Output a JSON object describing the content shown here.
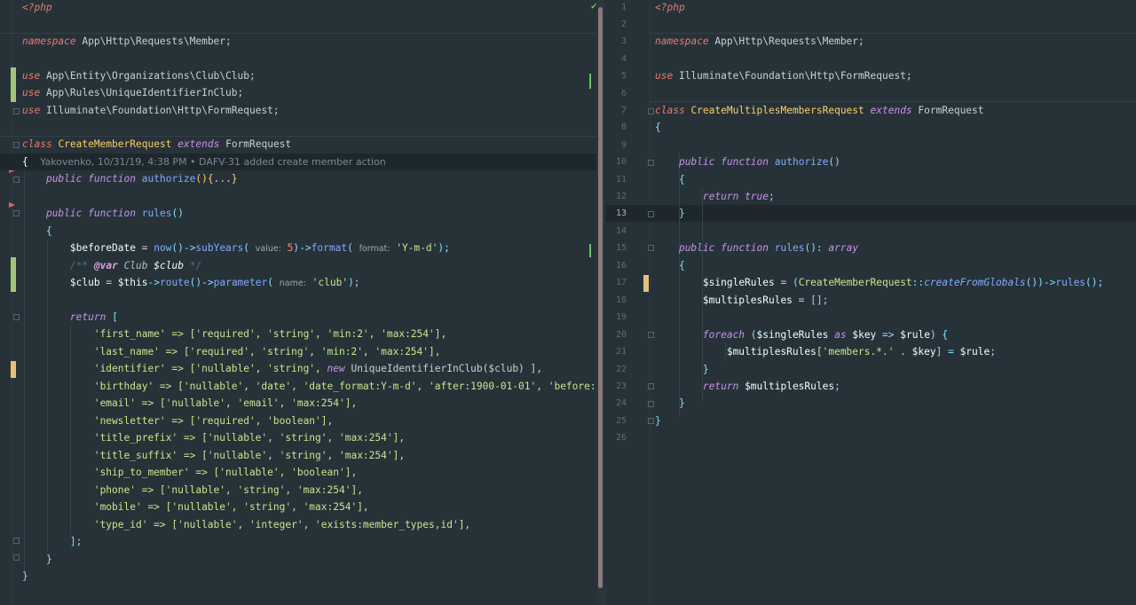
{
  "left": {
    "php_open": "<?php",
    "namespace_kw": "namespace",
    "namespace_value": "App\\Http\\Requests\\Member;",
    "use_kw": "use",
    "use1": "App\\Entity\\Organizations\\Club\\Club;",
    "use2": "App\\Rules\\UniqueIdentifierInClub;",
    "use3": "Illuminate\\Foundation\\Http\\FormRequest;",
    "class_kw": "class",
    "class_name": "CreateMemberRequest",
    "extends_kw": "extends",
    "parent": "FormRequest",
    "blame_brace": "{",
    "blame": "Yakovenko, 10/31/19, 4:38 PM • DAFV-31 added create member action",
    "public_kw": "public",
    "function_kw": "function",
    "authorize_fn": "authorize",
    "authorize_folded": "(){...}",
    "rules_fn": "rules",
    "parens": "()",
    "brace_open": "{",
    "brace_close": "}",
    "before_var": "$beforeDate",
    "eq": " = ",
    "now_fn": "now",
    "arrow": "()->",
    "subyears_fn": "subYears",
    "paren_open": "(",
    "hint_value": "value:",
    "five": "5",
    "arrow_close": ")->",
    "format_fn": "format",
    "hint_format": "format:",
    "ymd": "'Y-m-d'",
    "stmt_end": ");",
    "docblock_open": "/**",
    "docblock_var": "@var",
    "docblock_type": "Club",
    "docblock_name": "$club",
    "docblock_close": "*/",
    "club_var": "$club",
    "this_var": "$this",
    "arrow_op": "->",
    "route_fn": "route",
    "parameter_fn": "parameter",
    "hint_name": "name:",
    "club_str": "'club'",
    "return_kw": "return",
    "array_open": "[",
    "array_close": "];",
    "r_first_name": "'first_name' => ['required', 'string', 'min:2', 'max:254'],",
    "r_last_name": "'last_name' => ['required', 'string', 'min:2', 'max:254'],",
    "r_identifier_a": "'identifier' => ['nullable', 'string', ",
    "r_identifier_new": "new",
    "r_identifier_b": " UniqueIdentifierInClub($club) ],",
    "r_birthday": "'birthday' => ['nullable', 'date', 'date_format:Y-m-d', 'after:1900-01-01', 'before:' .",
    "r_email": "'email' => ['nullable', 'email', 'max:254'],",
    "r_newsletter": "'newsletter' => ['required', 'boolean'],",
    "r_title_prefix": "'title_prefix' => ['nullable', 'string', 'max:254'],",
    "r_title_suffix": "'title_suffix' => ['nullable', 'string', 'max:254'],",
    "r_ship": "'ship_to_member' => ['nullable', 'boolean'],",
    "r_phone": "'phone' => ['nullable', 'string', 'max:254'],",
    "r_mobile": "'mobile' => ['nullable', 'string', 'max:254'],",
    "r_type_id": "'type_id' => ['nullable', 'integer', 'exists:member_types,id'],",
    "method_close": "}",
    "class_close": "}"
  },
  "right": {
    "line_numbers": [
      "1",
      "2",
      "3",
      "4",
      "5",
      "6",
      "7",
      "8",
      "9",
      "10",
      "11",
      "12",
      "13",
      "14",
      "15",
      "16",
      "17",
      "18",
      "19",
      "20",
      "21",
      "22",
      "23",
      "24",
      "25",
      "26"
    ],
    "php_open": "<?php",
    "namespace_kw": "namespace",
    "namespace_value": "App\\Http\\Requests\\Member;",
    "use_kw": "use",
    "use1": "Illuminate\\Foundation\\Http\\FormRequest;",
    "class_kw": "class",
    "class_name": "CreateMultiplesMembersRequest",
    "extends_kw": "extends",
    "parent": "FormRequest",
    "brace_open": "{",
    "brace_close": "}",
    "public_kw": "public",
    "function_kw": "function",
    "authorize_fn": "authorize",
    "parens": "()",
    "return_kw": "return",
    "true_kw": "true",
    "semicolon": ";",
    "rules_fn": "rules",
    "rules_ret": "(): ",
    "array_type": "array",
    "single_var": "$singleRules",
    "eq": " = ",
    "create_open": "(",
    "create_cls": "CreateMemberRequest",
    "double_colon": "::",
    "create_fn": "createFromGlobals",
    "create_tail": "())->",
    "rules_call": "rules",
    "call_end": "();",
    "multiples_var": "$multiplesRules",
    "empty_array": "[];",
    "foreach_kw": "foreach",
    "foreach_open": " (",
    "as_kw": "as",
    "key_var": "$key",
    "double_arrow": " => ",
    "rule_var": "$rule",
    "foreach_close": ") {",
    "members_str": "['members.*.' . ",
    "members_close": "] = ",
    "stmt_end": ";"
  }
}
